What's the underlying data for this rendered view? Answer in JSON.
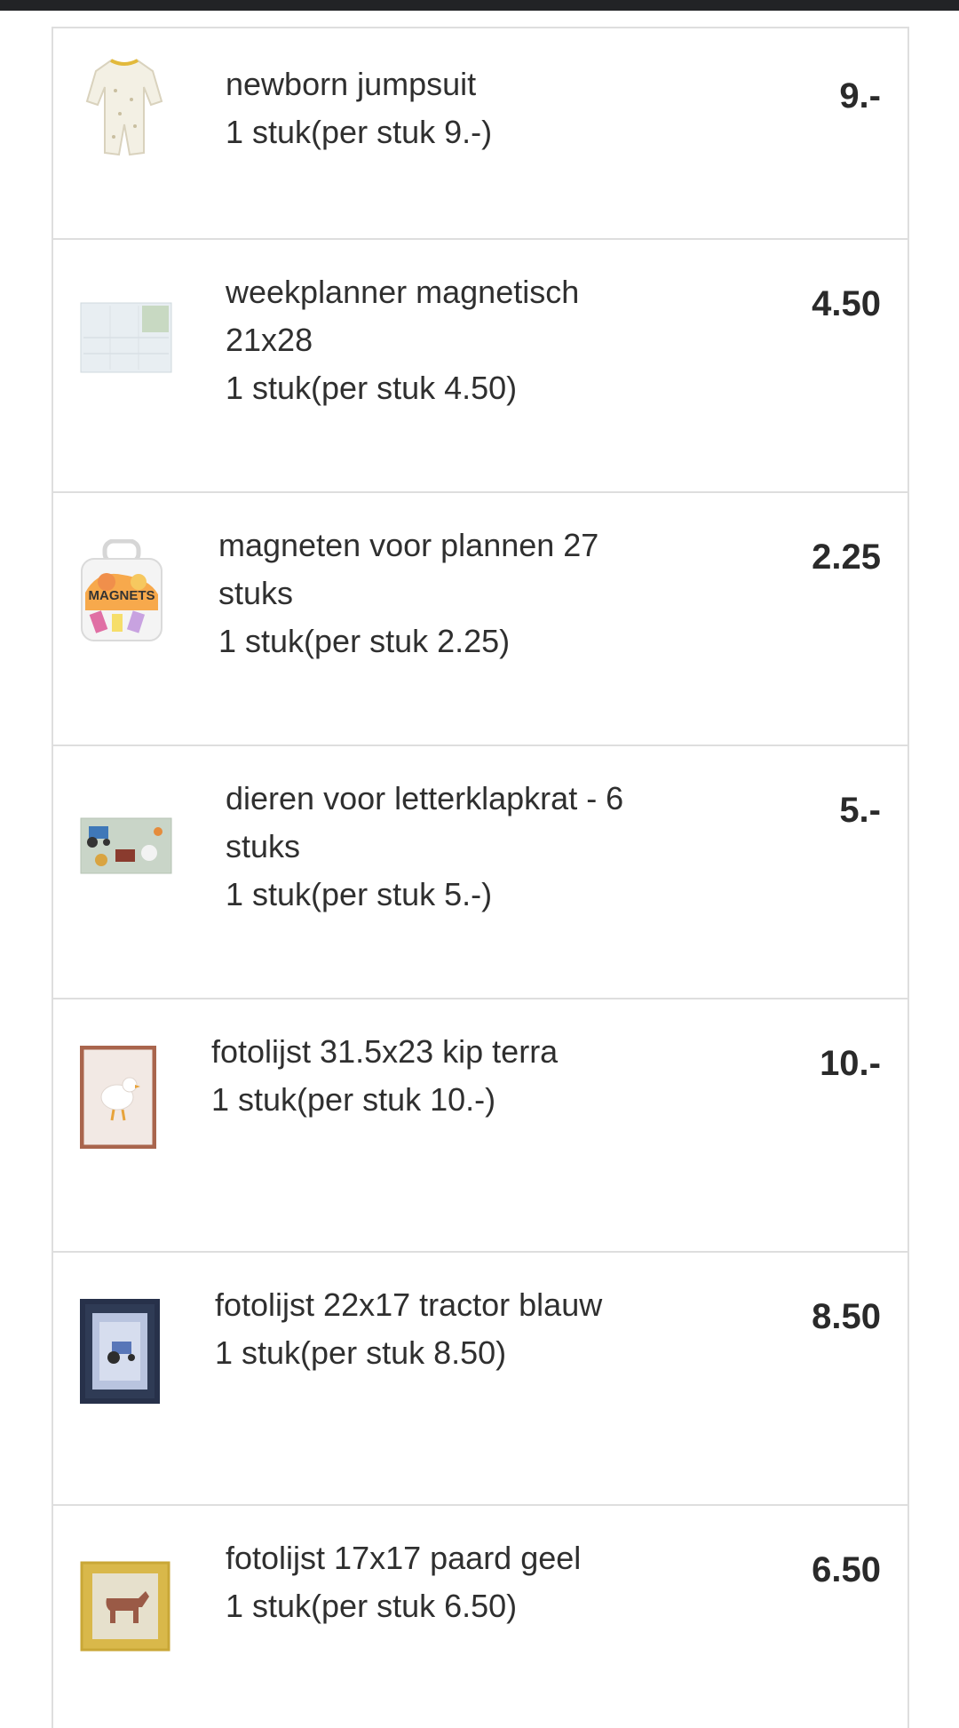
{
  "items": [
    {
      "name": "newborn jumpsuit",
      "qty": "1 stuk(per stuk 9.-)",
      "price": "9.-",
      "thumb": "jumpsuit-icon"
    },
    {
      "name": "weekplanner magnetisch 21x28",
      "qty": "1 stuk(per stuk 4.50)",
      "price": "4.50",
      "thumb": "weekplanner-icon"
    },
    {
      "name": "magneten voor plannen 27 stuks",
      "qty": "1 stuk(per stuk 2.25)",
      "price": "2.25",
      "thumb": "magnets-icon",
      "thumb_text": "MAGNETS"
    },
    {
      "name": "dieren voor letterklapkrat - 6 stuks",
      "qty": "1 stuk(per stuk 5.-)",
      "price": "5.-",
      "thumb": "animals-icon"
    },
    {
      "name": "fotolijst 31.5x23 kip terra",
      "qty": "1 stuk(per stuk 10.-)",
      "price": "10.-",
      "thumb": "frame-chicken-icon"
    },
    {
      "name": "fotolijst 22x17 tractor blauw",
      "qty": "1 stuk(per stuk 8.50)",
      "price": "8.50",
      "thumb": "frame-tractor-icon"
    },
    {
      "name": "fotolijst 17x17 paard geel",
      "qty": "1 stuk(per stuk 6.50)",
      "price": "6.50",
      "thumb": "frame-horse-icon"
    }
  ]
}
